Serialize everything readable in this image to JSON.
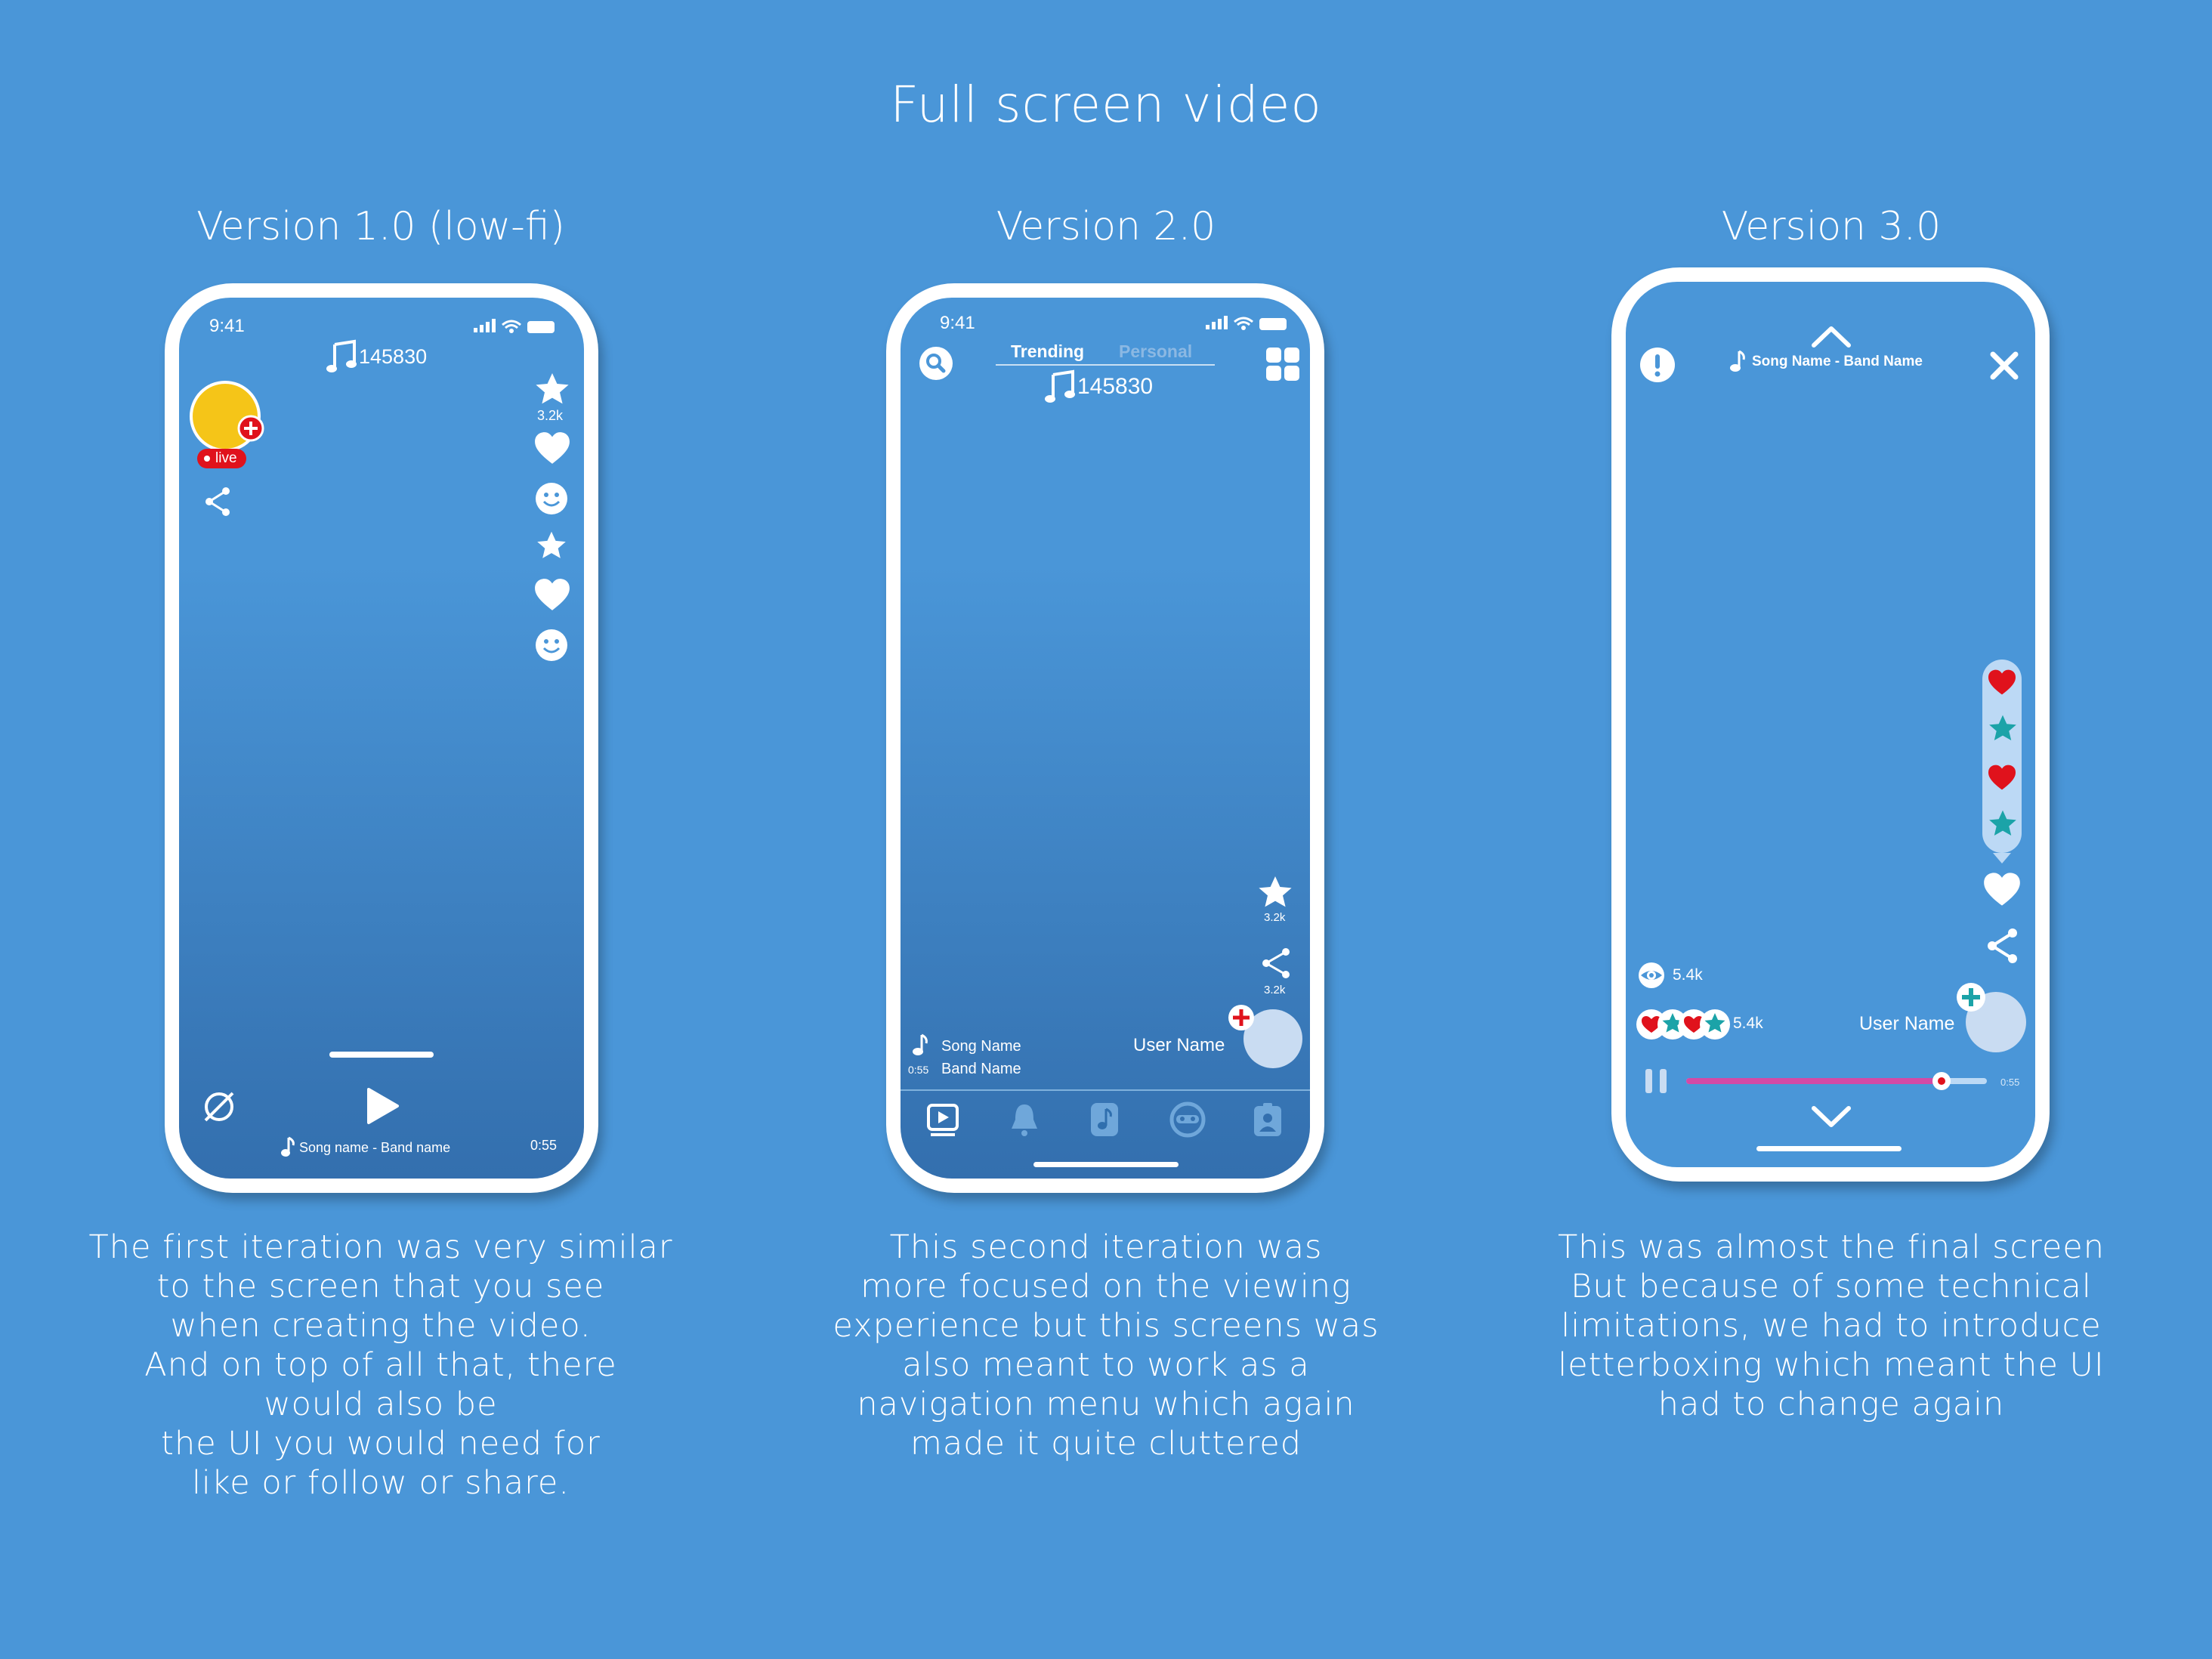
{
  "page": {
    "title": "Full screen video"
  },
  "v1": {
    "title": "Version 1.0 (low-fi)",
    "time": "9:41",
    "music_count": "145830",
    "live_badge": "live",
    "star_count": "3.2k",
    "song": "Song name - Band name",
    "duration": "0:55",
    "description": [
      "The first iteration was very similar",
      "to the screen that you see",
      "when creating the video.",
      "And on top of all that, there",
      "would also be",
      "the UI you would need for",
      "like or follow or share."
    ]
  },
  "v2": {
    "title": "Version 2.0",
    "time": "9:41",
    "tabs": [
      "Trending",
      "Personal"
    ],
    "music_count": "145830",
    "star_count": "3.2k",
    "share_count": "3.2k",
    "song_name": "Song Name",
    "band_name": "Band Name",
    "elapsed": "0:55",
    "user_name": "User Name",
    "nav_icons": [
      "video-play-icon",
      "bell-icon",
      "music-note-icon",
      "mask-icon",
      "profile-icon"
    ],
    "description": [
      "This second iteration was",
      "more focused on the viewing",
      "experience but this screens was",
      "also meant to work as a",
      "navigation menu which again",
      "made it quite cluttered"
    ]
  },
  "v3": {
    "title": "Version 3.0",
    "song": "Song Name - Band Name",
    "views": "5.4k",
    "reactions": "5.4k",
    "user_name": "User Name",
    "duration": "0:55",
    "progress": 0.85,
    "description": [
      "This was almost the final screen",
      "But because of some technical",
      "limitations, we had to introduce",
      "letterboxing which meant the UI",
      "had to change again"
    ]
  },
  "colors": {
    "background": "#4a96d8",
    "live_red": "#e0121c",
    "heart_red": "#e0121c",
    "star_teal": "#1ba3a8",
    "progress_pink": "#d44aa6",
    "avatar_yellow": "#f5c518"
  }
}
